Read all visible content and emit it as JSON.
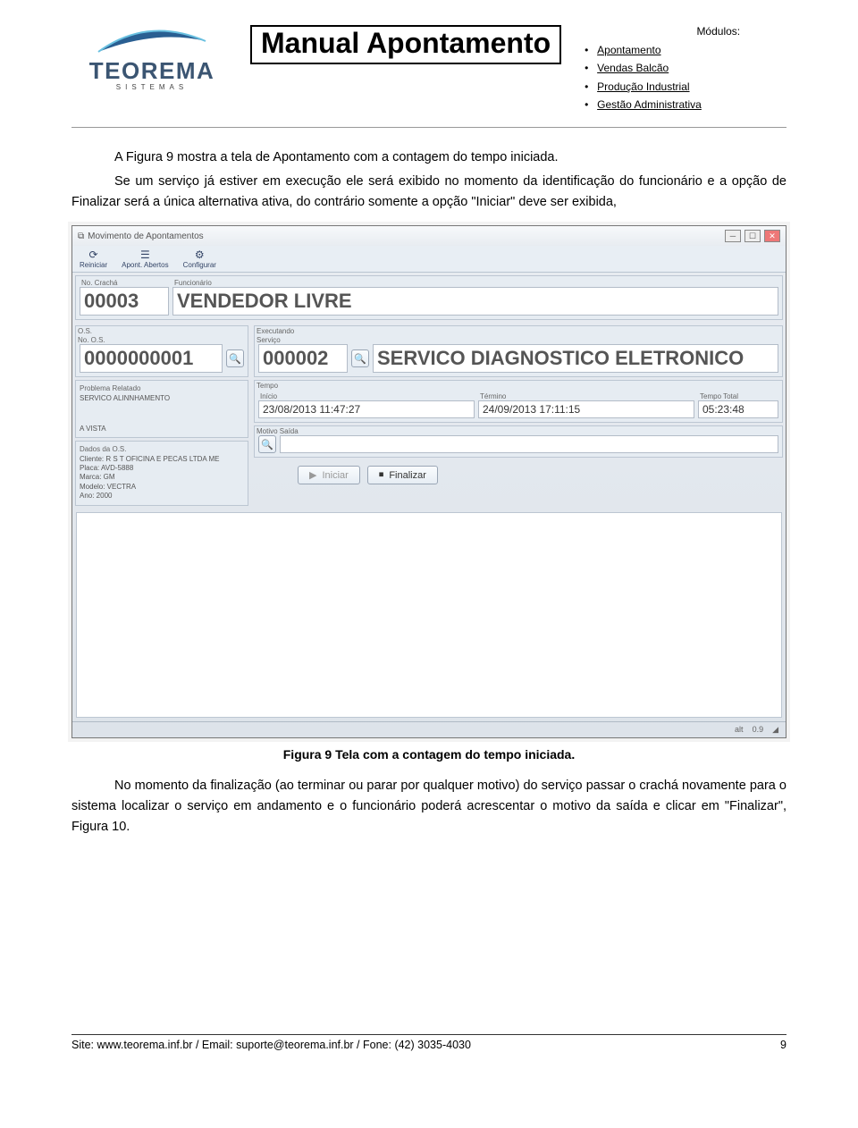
{
  "header": {
    "logo": {
      "name": "TEOREMA",
      "subtitle": "SISTEMAS"
    },
    "title": "Manual Apontamento",
    "modules": {
      "label": "Módulos:",
      "items": [
        "Apontamento",
        "Vendas Balcão",
        "Produção Industrial",
        "Gestão Administrativa"
      ]
    }
  },
  "body": {
    "para1": "A Figura 9 mostra a tela de Apontamento com a contagem do tempo iniciada.",
    "para2": "Se um serviço já estiver em execução ele será exibido no momento da identificação do funcionário e a opção de Finalizar será a única alternativa ativa, do contrário somente a opção \"Iniciar\" deve ser exibida,"
  },
  "app": {
    "window_title": "Movimento de Apontamentos",
    "toolbar": {
      "reiniciar": "Reiniciar",
      "apont_abertos": "Apont. Abertos",
      "configurar": "Configurar"
    },
    "labels": {
      "no_cracha": "No. Crachá",
      "funcionario": "Funcionário",
      "os": "O.S.",
      "no_os": "No. O.S.",
      "executando": "Executando",
      "servico": "Serviço",
      "problema": "Problema Relatado",
      "tempo": "Tempo",
      "inicio": "Início",
      "termino": "Término",
      "tempo_total": "Tempo Total",
      "motivo_saida": "Motivo Saída",
      "dados_os": "Dados da O.S."
    },
    "values": {
      "cracha": "00003",
      "funcionario": "VENDEDOR LIVRE",
      "no_os": "0000000001",
      "servico_code": "000002",
      "servico_desc": "SERVICO DIAGNOSTICO ELETRONICO",
      "problema_text": "SERVICO ALINNHAMENTO",
      "a_vista": "A VISTA",
      "inicio": "23/08/2013 11:47:27",
      "termino": "24/09/2013 17:11:15",
      "tempo_total": "05:23:48",
      "cliente_line1": "Cliente: R S T OFICINA E PECAS LTDA ME",
      "cliente_line2": "Placa: AVD-5888",
      "cliente_line3": "Marca: GM",
      "cliente_line4": "Modelo: VECTRA",
      "cliente_line5": "Ano: 2000"
    },
    "buttons": {
      "iniciar": "Iniciar",
      "finalizar": "Finalizar"
    },
    "status": {
      "alt": "alt",
      "zoom": "0.9"
    }
  },
  "caption": "Figura 9 Tela com a contagem do tempo iniciada.",
  "body2": {
    "para3": "No momento da finalização (ao terminar ou parar por qualquer motivo) do serviço passar o crachá novamente para o sistema localizar o serviço em andamento e o funcionário poderá acrescentar o motivo da saída e clicar em \"Finalizar\", Figura 10."
  },
  "footer": {
    "left": "Site: www.teorema.inf.br / Email: suporte@teorema.inf.br / Fone: (42) 3035-4030",
    "page": "9"
  }
}
